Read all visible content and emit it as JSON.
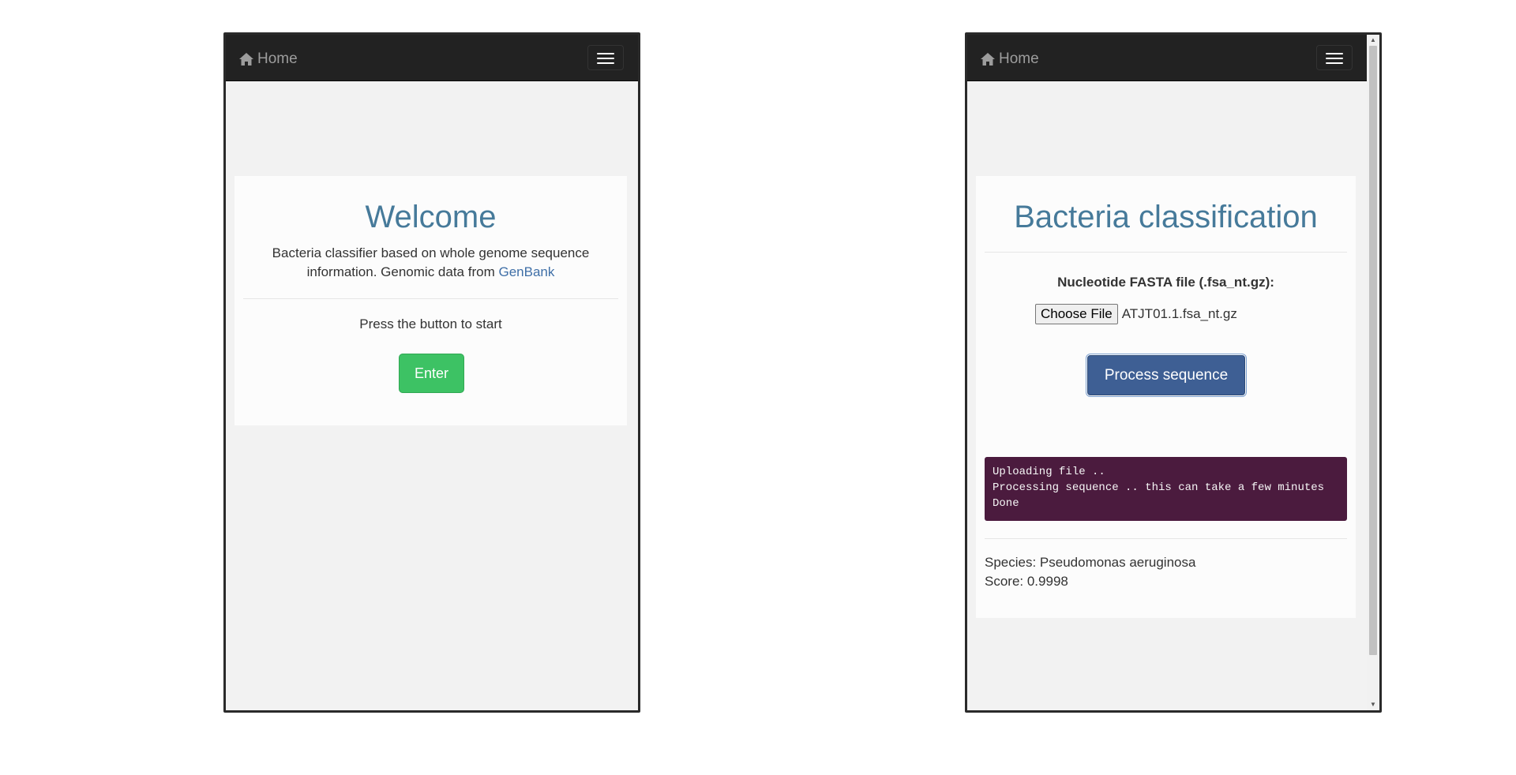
{
  "left_screen": {
    "navbar": {
      "brand": "Home"
    },
    "card": {
      "title": "Welcome",
      "description": "Bacteria classifier based on whole genome sequence information. Genomic data from",
      "link_text": "GenBank",
      "prompt": "Press the button to start",
      "enter_button": "Enter"
    }
  },
  "right_screen": {
    "navbar": {
      "brand": "Home"
    },
    "card": {
      "title": "Bacteria classification",
      "file_label": "Nucleotide FASTA file (.fsa_nt.gz):",
      "choose_file_button": "Choose File",
      "file_name": "ATJT01.1.fsa_nt.gz",
      "process_button": "Process sequence",
      "console_lines": [
        "Uploading file ..",
        "Processing sequence .. this can take a few minutes",
        "Done"
      ],
      "species_line": "Species: Pseudomonas aeruginosa",
      "score_line": "Score: 0.9998"
    }
  },
  "colors": {
    "title": "#467a9a",
    "enter_button": "#3dc264",
    "process_button": "#3e5f94",
    "console_bg": "#4b1b3e",
    "navbar_bg": "#222222"
  },
  "icons": {
    "brand": "home-icon",
    "menu": "hamburger-menu-icon"
  }
}
